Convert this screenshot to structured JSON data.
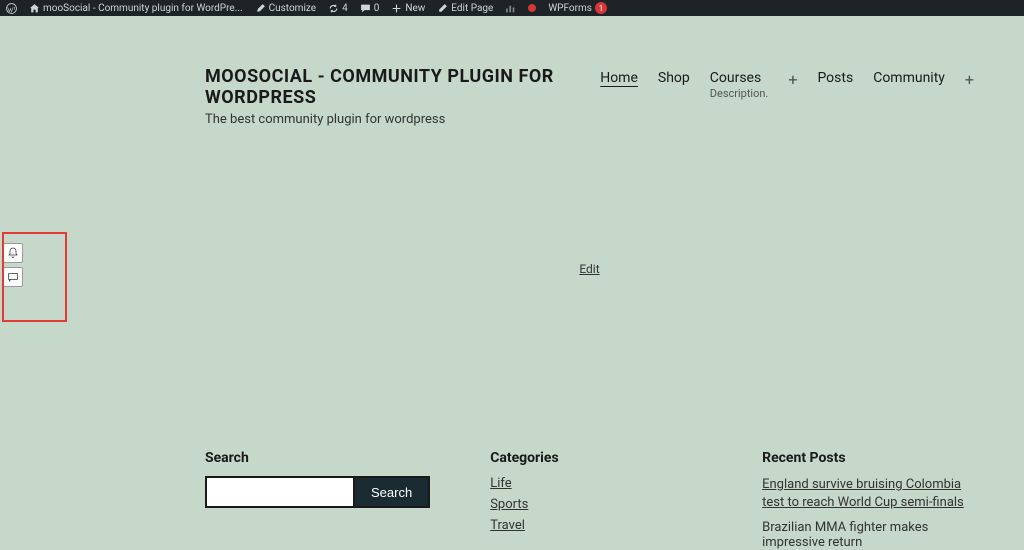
{
  "adminbar": {
    "site_name": "mooSocial - Community plugin for WordPre...",
    "customize": "Customize",
    "updates_count": "4",
    "comments_count": "0",
    "new": "New",
    "edit_page": "Edit Page",
    "wpforms": "WPForms",
    "wpforms_badge": "1"
  },
  "site": {
    "title": "MOOSOCIAL - COMMUNITY PLUGIN FOR WORDPRESS",
    "tagline": "The best community plugin for wordpress"
  },
  "nav": {
    "home": "Home",
    "shop": "Shop",
    "courses": "Courses",
    "courses_desc": "Description.",
    "posts": "Posts",
    "community": "Community"
  },
  "edit_link": "Edit",
  "widgets": {
    "search": {
      "title": "Search",
      "button": "Search"
    },
    "categories": {
      "title": "Categories",
      "items": [
        "Life",
        "Sports",
        "Travel"
      ]
    },
    "recent_posts": {
      "title": "Recent Posts",
      "items": [
        "England survive bruising Colombia test to reach World Cup semi-finals",
        "Brazilian MMA fighter makes impressive return"
      ]
    }
  }
}
